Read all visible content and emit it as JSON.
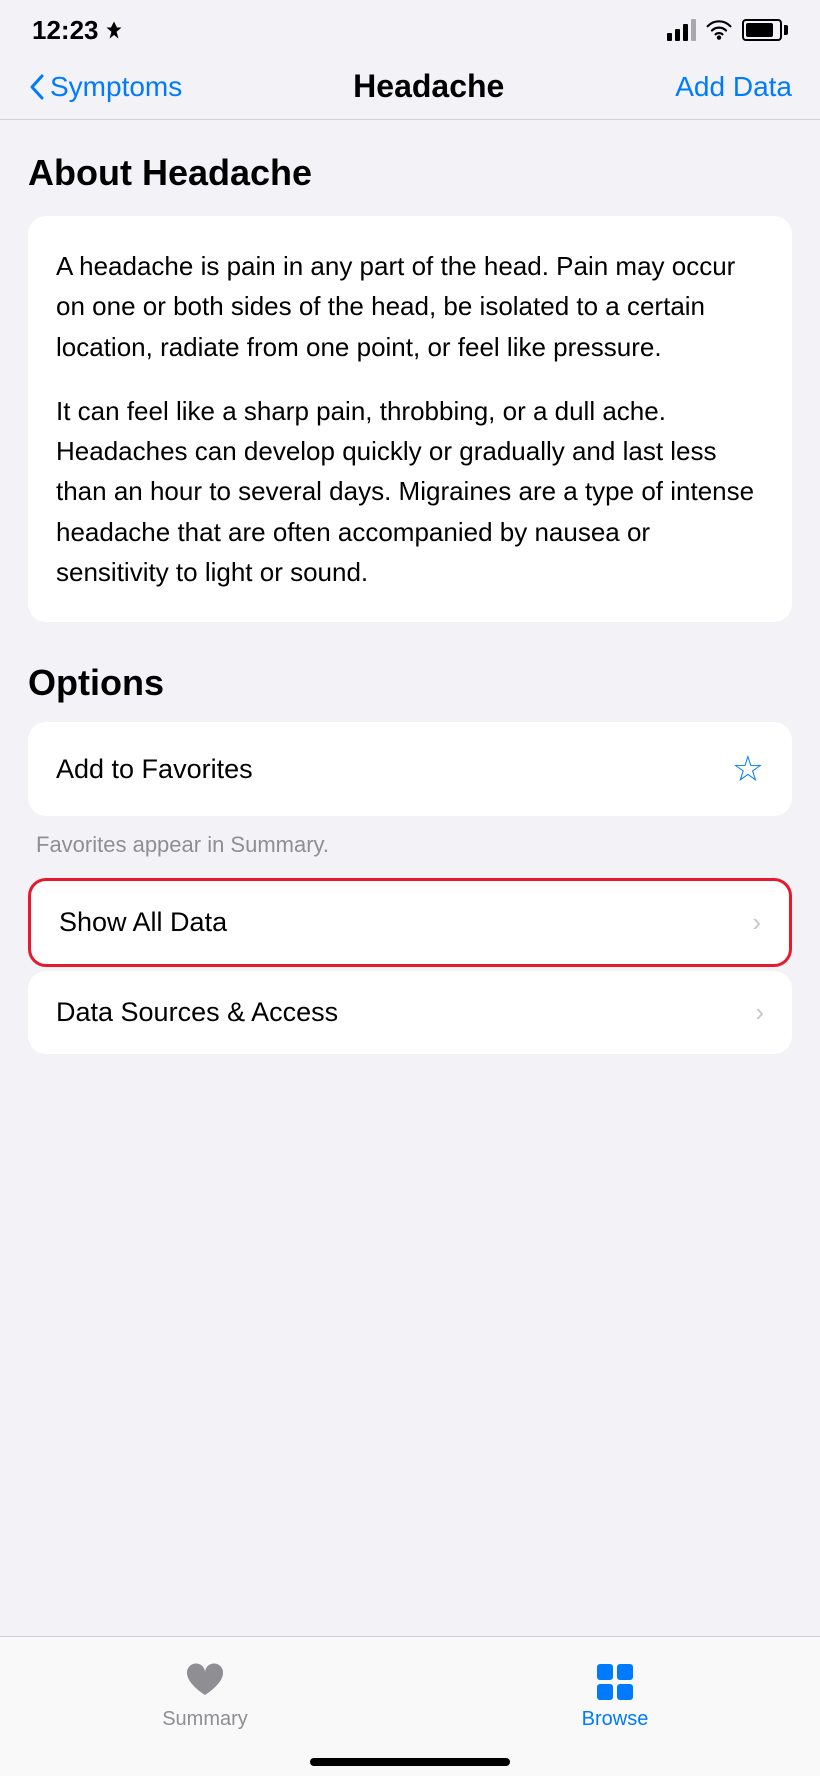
{
  "statusBar": {
    "time": "12:23",
    "locationIcon": "▲"
  },
  "navBar": {
    "backLabel": "Symptoms",
    "title": "Headache",
    "actionLabel": "Add Data"
  },
  "aboutSection": {
    "heading": "About Headache",
    "paragraph1": "A headache is pain in any part of the head. Pain may occur on one or both sides of the head, be isolated to a certain location, radiate from one point, or feel like pressure.",
    "paragraph2": "It can feel like a sharp pain, throbbing, or a dull ache. Headaches can develop quickly or gradually and last less than an hour to several days. Migraines are a type of intense headache that are often accompanied by nausea or sensitivity to light or sound."
  },
  "optionsSection": {
    "heading": "Options",
    "addToFavorites": "Add to Favorites",
    "favoritesHint": "Favorites appear in Summary.",
    "showAllData": "Show All Data",
    "dataSourcesAccess": "Data Sources & Access"
  },
  "tabBar": {
    "summaryLabel": "Summary",
    "browseLabel": "Browse"
  }
}
